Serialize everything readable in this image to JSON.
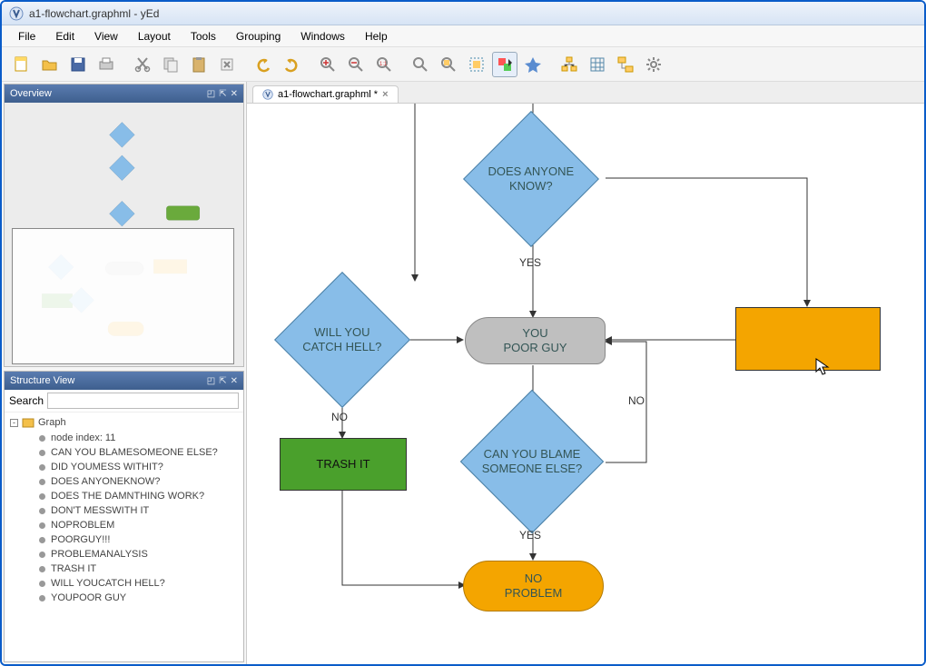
{
  "window": {
    "title": "a1-flowchart.graphml - yEd"
  },
  "menus": [
    "File",
    "Edit",
    "View",
    "Layout",
    "Tools",
    "Grouping",
    "Windows",
    "Help"
  ],
  "panels": {
    "overview": {
      "title": "Overview"
    },
    "structure": {
      "title": "Structure View",
      "search_label": "Search"
    }
  },
  "tab": {
    "label": "a1-flowchart.graphml *"
  },
  "tree": {
    "root": "Graph",
    "first": "node index: 11",
    "items": [
      "CAN YOU BLAMESOMEONE ELSE?",
      "DID YOUMESS WITHIT?",
      "DOES ANYONEKNOW?",
      "DOES THE DAMNTHING WORK?",
      "DON'T MESSWITH IT",
      "NOPROBLEM",
      "POORGUY!!!",
      "PROBLEMANALYSIS",
      "TRASH IT",
      "WILL YOUCATCH HELL?",
      "YOUPOOR GUY"
    ]
  },
  "flowchart": {
    "does_anyone_know": "DOES ANYONE\nKNOW?",
    "will_you_catch_hell": "WILL YOU\nCATCH HELL?",
    "you_poor_guy": "YOU\nPOOR GUY",
    "can_you_blame": "CAN YOU BLAME\nSOMEONE ELSE?",
    "trash_it": "TRASH IT",
    "no_problem": "NO\nPROBLEM",
    "yes1": "YES",
    "yes2": "YES",
    "no1": "NO",
    "no2": "NO"
  },
  "colors": {
    "blue": "#88bde8",
    "green": "#4aa02c",
    "orange": "#f4a500",
    "grey": "#bfbfbf"
  }
}
